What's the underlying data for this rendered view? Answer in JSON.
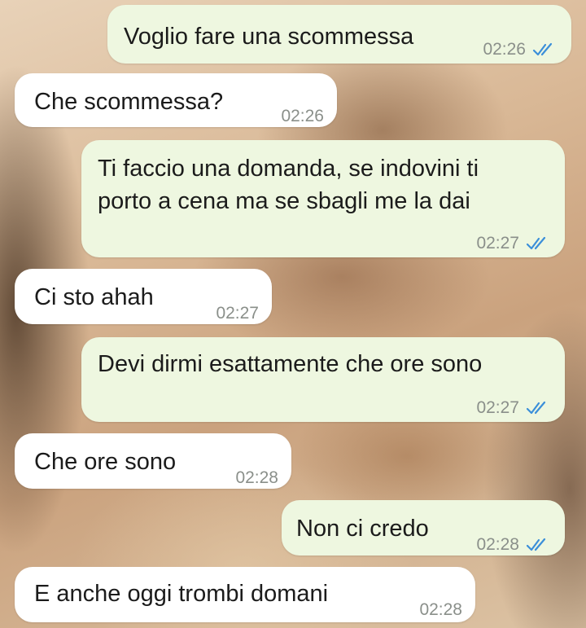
{
  "colors": {
    "outgoing_bubble": "#eef7e0",
    "incoming_bubble": "#ffffff",
    "read_ticks": "#3b8fd9",
    "timestamp": "#8a8f8a"
  },
  "messages": [
    {
      "direction": "outgoing",
      "lines": [
        "Voglio fare una scommessa"
      ],
      "time": "02:26",
      "status_icon": "double-check-read"
    },
    {
      "direction": "incoming",
      "lines": [
        "Che scommessa?"
      ],
      "time": "02:26"
    },
    {
      "direction": "outgoing",
      "lines": [
        "Ti faccio una domanda, se indovini ti",
        "porto a cena ma se sbagli me la dai"
      ],
      "time": "02:27",
      "status_icon": "double-check-read"
    },
    {
      "direction": "incoming",
      "lines": [
        "Ci sto ahah"
      ],
      "time": "02:27"
    },
    {
      "direction": "outgoing",
      "lines": [
        "Devi dirmi esattamente che ore sono"
      ],
      "time": "02:27",
      "status_icon": "double-check-read"
    },
    {
      "direction": "incoming",
      "lines": [
        "Che ore sono"
      ],
      "time": "02:28"
    },
    {
      "direction": "outgoing",
      "lines": [
        "Non ci credo"
      ],
      "time": "02:28",
      "status_icon": "double-check-read"
    },
    {
      "direction": "incoming",
      "lines": [
        "E anche oggi trombi domani"
      ],
      "time": "02:28"
    }
  ]
}
